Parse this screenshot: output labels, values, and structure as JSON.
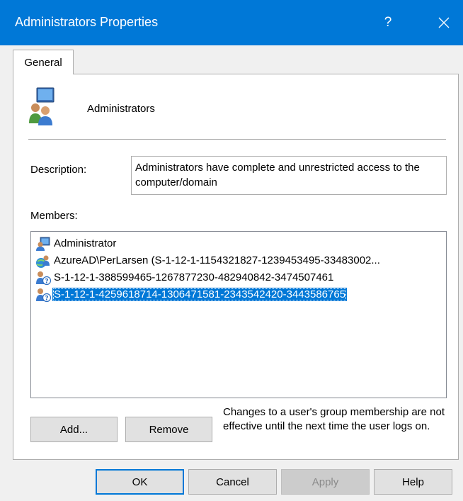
{
  "window": {
    "title": "Administrators Properties",
    "help_label": "?",
    "accent": "#0078d7"
  },
  "tabs": [
    {
      "label": "General",
      "active": true
    }
  ],
  "group": {
    "name": "Administrators",
    "icon": "group-users-icon"
  },
  "description": {
    "label": "Description:",
    "value": "Administrators have complete and unrestricted access to the computer/domain"
  },
  "members": {
    "label": "Members:",
    "items": [
      {
        "name": "Administrator",
        "icon": "local-user-icon",
        "selected": false
      },
      {
        "name": "AzureAD\\PerLarsen (S-1-12-1-1154321827-1239453495-33483002...",
        "icon": "azure-user-icon",
        "selected": false
      },
      {
        "name": "S-1-12-1-388599465-1267877230-482940842-3474507461",
        "icon": "unknown-user-icon",
        "selected": false
      },
      {
        "name": "S-1-12-1-4259618714-1306471581-2343542420-3443586765",
        "icon": "unknown-user-icon",
        "selected": true
      }
    ]
  },
  "actions": {
    "add_label": "Add...",
    "remove_label": "Remove",
    "note": "Changes to a user's group membership are not effective until the next time the user logs on."
  },
  "footer": {
    "ok_label": "OK",
    "cancel_label": "Cancel",
    "apply_label": "Apply",
    "apply_enabled": false,
    "help_label": "Help"
  }
}
